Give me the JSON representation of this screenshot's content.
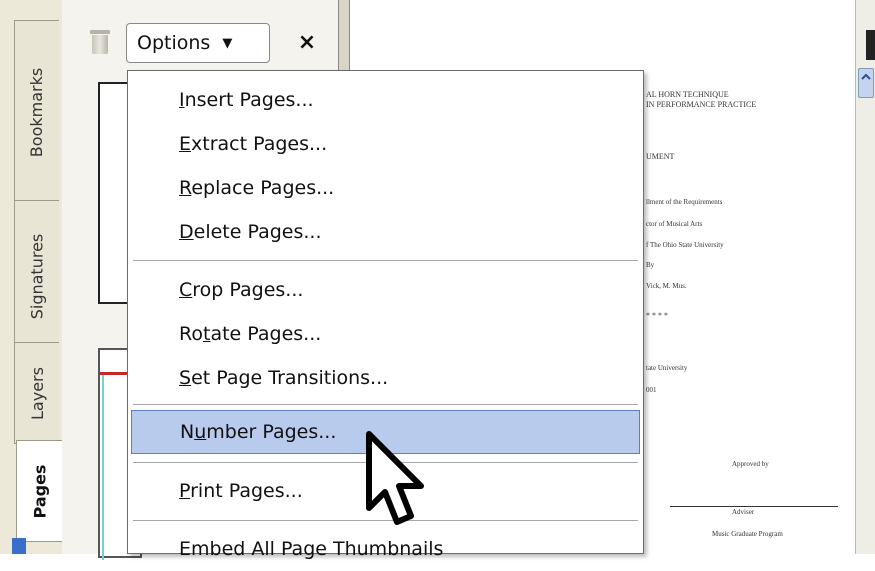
{
  "left_tabs": [
    {
      "label": "Bookmarks"
    },
    {
      "label": "Signatures"
    },
    {
      "label": "Layers"
    },
    {
      "label": "Pages"
    }
  ],
  "toolbar": {
    "options_label": "Options",
    "options_arrow": "▼",
    "close_symbol": "×"
  },
  "menu": {
    "items": [
      {
        "label": "Insert Pages...",
        "mnemonic_index": 0
      },
      {
        "label": "Extract Pages...",
        "mnemonic_index": 0
      },
      {
        "label": "Replace Pages...",
        "mnemonic_index": 0
      },
      {
        "label": "Delete Pages...",
        "mnemonic_index": 0
      },
      {
        "label": "Crop Pages...",
        "mnemonic_index": 0
      },
      {
        "label": "Rotate Pages...",
        "mnemonic_index": 2
      },
      {
        "label": "Set Page Transitions...",
        "mnemonic_index": 0
      },
      {
        "label": "Number Pages...",
        "mnemonic_index": 1,
        "highlighted": true
      },
      {
        "label": "Print Pages...",
        "mnemonic_index": 0
      },
      {
        "label": "Embed All Page Thumbnails"
      }
    ]
  },
  "document": {
    "lines": [
      "AL HORN TECHNIQUE",
      "IN PERFORMANCE PRACTICE",
      "UMENT",
      "llment of the Requirements",
      "ctor of Musical Arts",
      "f The Ohio State University",
      "By",
      "Vick, M. Mus.",
      "* * * *",
      "tate University",
      "001",
      "Approved by",
      "Adviser",
      "Music Graduate Program"
    ]
  }
}
